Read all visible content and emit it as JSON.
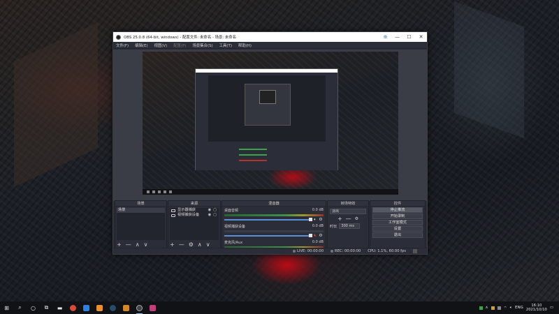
{
  "window": {
    "title": "OBS 25.0.8 (64-bit, windows) - 配置文件: 未命名 - 场景: 未命名",
    "controls": {
      "pin": "⊕",
      "minimize": "—",
      "maximize": "☐",
      "close": "✕"
    }
  },
  "menu": [
    "文件(F)",
    "编辑(E)",
    "视图(V)",
    "配置(P)",
    "场景集合(S)",
    "工具(T)",
    "帮助(H)"
  ],
  "menu_disabled": "配置(P)",
  "docks": {
    "scenes": {
      "title": "场景",
      "items": [
        "场景"
      ],
      "footer": [
        "+",
        "—",
        "∧",
        "∨"
      ]
    },
    "sources": {
      "title": "来源",
      "items": [
        {
          "label": "显示器捕获",
          "icon": "monitor-icon"
        },
        {
          "label": "视频捕获设备",
          "icon": "camera-icon"
        }
      ],
      "footer": [
        "+",
        "—",
        "⚙",
        "∧",
        "∨"
      ]
    },
    "mixer": {
      "title": "混音器",
      "channels": [
        {
          "name": "桌面音频",
          "db": "0.0 dB",
          "muted": false
        },
        {
          "name": "视频捕获设备",
          "db": "0.0 dB",
          "muted": true
        },
        {
          "name": "麦克风/Aux",
          "db": "0.0 dB",
          "muted": false
        }
      ]
    },
    "transitions": {
      "title": "转场特效",
      "selected": "淡出",
      "duration_label": "时长",
      "duration_value": "300 ms",
      "buttons": [
        "+",
        "—",
        "⚙"
      ]
    },
    "controls": {
      "title": "控件",
      "buttons": [
        "停止推流",
        "开始录制",
        "工作室模式",
        "设置",
        "退出"
      ]
    }
  },
  "status": {
    "live_label": "LIVE:",
    "live_time": "00:00:00",
    "rec_label": "REC:",
    "rec_time": "00:00:00",
    "cpu": "CPU: 1.1%, 60.00 fps"
  },
  "taskbar": {
    "start": "⊞",
    "search": "⌕",
    "apps": [
      {
        "name": "chrome-icon",
        "color": "#d64a3a"
      },
      {
        "name": "app-blue-icon",
        "color": "#2d7fe0"
      },
      {
        "name": "app-orange-icon",
        "color": "#e8912d"
      },
      {
        "name": "steam-icon",
        "color": "#2a4a6b"
      },
      {
        "name": "app-amber-icon",
        "color": "#d08a2a"
      },
      {
        "name": "obs-icon",
        "color": "#444"
      },
      {
        "name": "app-pink-icon",
        "color": "#c0407a"
      }
    ],
    "lang": "ENG",
    "time": "16:10",
    "date": "2021/10/10"
  }
}
